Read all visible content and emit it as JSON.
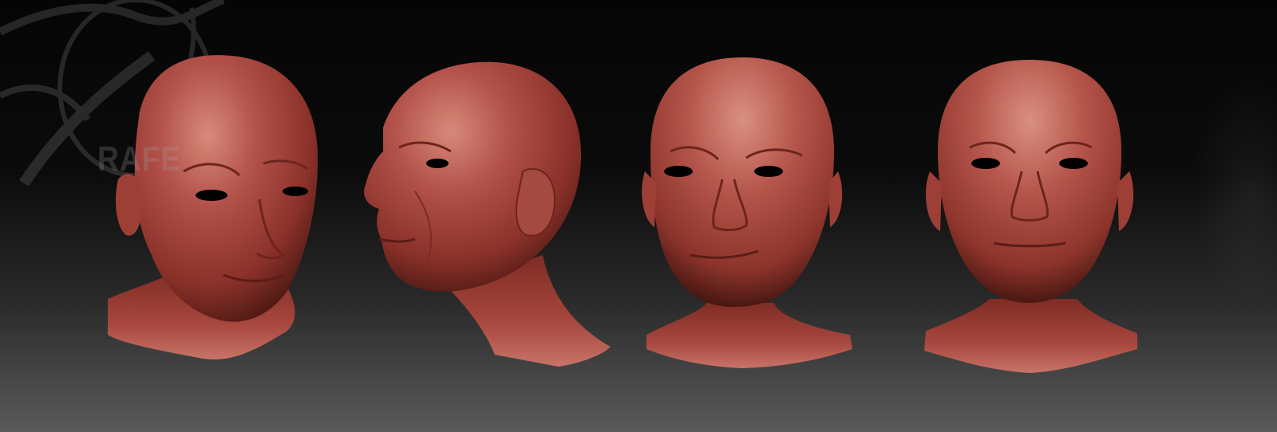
{
  "scene": {
    "type": "3d-sculpt-turnaround",
    "background": {
      "top": "#050505",
      "bottom": "#5a5a5a"
    },
    "material_color": "#a8473e",
    "material_highlight": "#d07a6c",
    "material_shadow": "#3e1410",
    "views": [
      {
        "name": "head-three-quarter-view"
      },
      {
        "name": "head-profile-view"
      },
      {
        "name": "head-front-smirk-view"
      },
      {
        "name": "head-front-view"
      }
    ]
  },
  "watermark": {
    "text": "RAFE",
    "color": "#a0a0a0"
  }
}
